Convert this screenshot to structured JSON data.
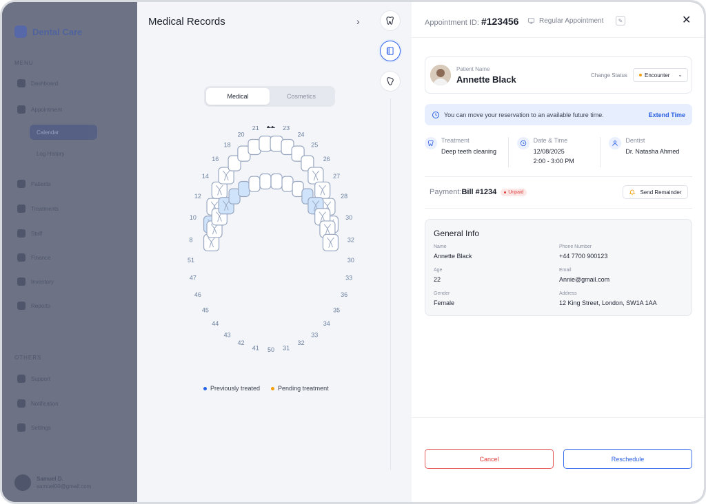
{
  "sidebar": {
    "brand": "Dental Care",
    "section_menu": "MENU",
    "section_others": "OTHERS",
    "items": [
      {
        "label": "Dashboard"
      },
      {
        "label": "Appointment"
      },
      {
        "label": "Calendar"
      },
      {
        "label": "Log History"
      },
      {
        "label": "Patients"
      },
      {
        "label": "Treatments"
      },
      {
        "label": "Staff"
      },
      {
        "label": "Finance"
      },
      {
        "label": "Inventory"
      },
      {
        "label": "Reports"
      }
    ],
    "others": [
      {
        "label": "Support"
      },
      {
        "label": "Notification"
      },
      {
        "label": "Settings"
      }
    ],
    "user": {
      "name": "Samuel D.",
      "email": "samuel00@gmail.com"
    }
  },
  "medical": {
    "title": "Medical Records",
    "tabs": [
      {
        "label": "Medical",
        "selected": true
      },
      {
        "label": "Cosmetics",
        "selected": false
      }
    ],
    "upper_numbers": [
      "8",
      "10",
      "12",
      "14",
      "16",
      "18",
      "20",
      "21",
      "22",
      "23",
      "24",
      "25",
      "26",
      "27",
      "28",
      "30",
      "32"
    ],
    "lower_numbers": [
      "51",
      "47",
      "46",
      "45",
      "44",
      "43",
      "42",
      "41",
      "50",
      "31",
      "32",
      "33",
      "34",
      "35",
      "36",
      "33",
      "30"
    ],
    "legend": [
      {
        "label": "Previously treated",
        "color": "#2563eb"
      },
      {
        "label": "Pending treatment",
        "color": "#f59e0b"
      }
    ],
    "colors": {
      "tooth_fill": "#ffffff",
      "tooth_stroke": "#9aa8c2",
      "tooth_treated": "#cfe3fb",
      "number": "#6b7f9e"
    }
  },
  "appointment": {
    "id_label": "Appointment ID:",
    "id_value": "#123456",
    "type": "Regular Appointment",
    "patient_label": "Patient Name",
    "patient_name": "Annette Black",
    "change_status_label": "Change Status",
    "status": "Encounter",
    "notice": "You can move your reservation to an available future time.",
    "notice_action": "Extend Time",
    "treatment_label": "Treatment",
    "treatment_value": "Deep teeth cleaning",
    "datetime_label": "Date & Time",
    "date_value": "12/08/2025",
    "time_value": "2:00 - 3:00 PM",
    "dentist_label": "Dentist",
    "dentist_value": "Dr. Natasha Ahmed",
    "payment_label": "Payment:",
    "bill": "Bill #1234",
    "payment_status": "Unpaid",
    "remind_label": "Send Remainder",
    "general": {
      "title": "General Info",
      "name_label": "Name",
      "name": "Annette Black",
      "phone_label": "Phone Number",
      "phone": "+44 7700 900123",
      "age_label": "Age",
      "age": "22",
      "email_label": "Email",
      "email": "Annie@gmail.com",
      "gender_label": "Gender",
      "gender": "Female",
      "address_label": "Address",
      "address": "12 King Street, London, SW1A 1AA"
    },
    "cancel_label": "Cancel",
    "reschedule_label": "Reschedule"
  }
}
